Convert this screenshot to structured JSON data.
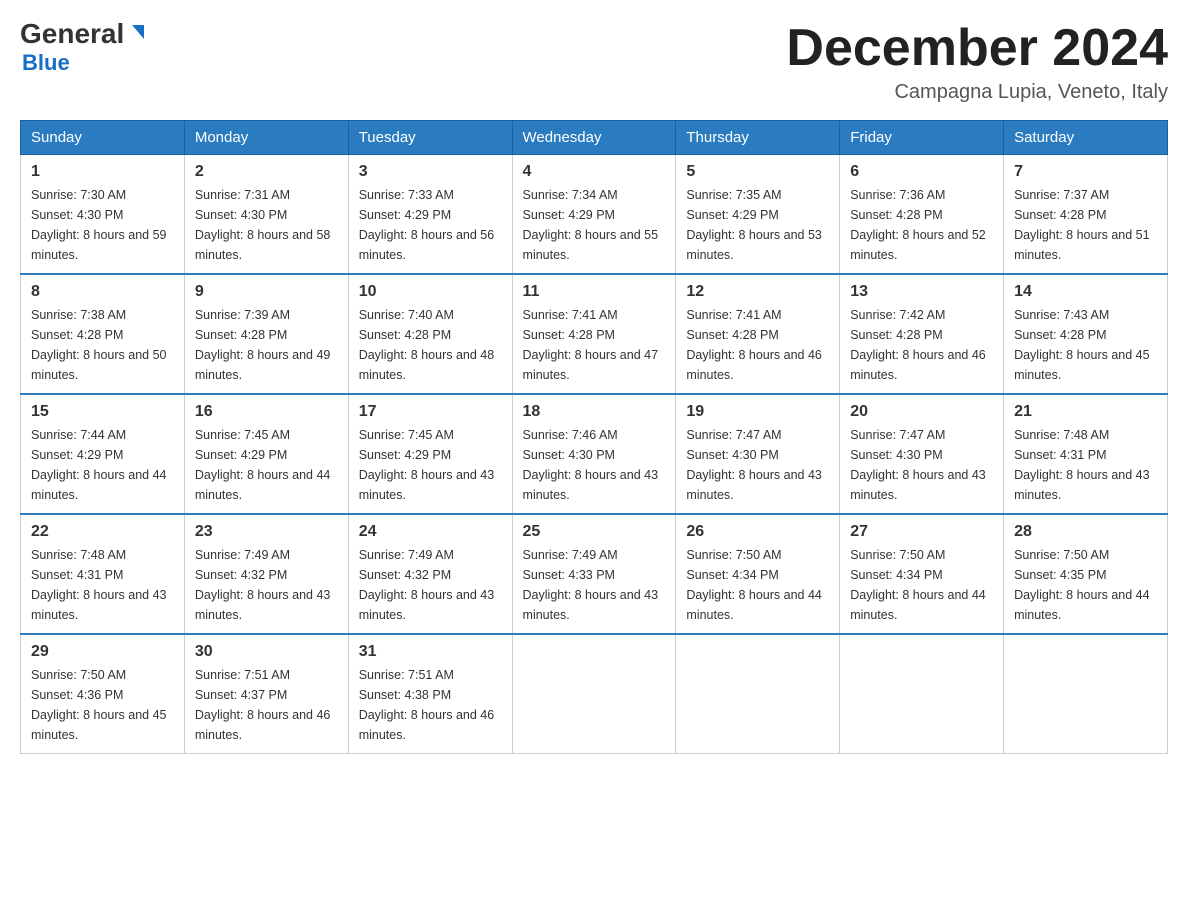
{
  "logo": {
    "general": "General",
    "blue": "Blue"
  },
  "title": "December 2024",
  "subtitle": "Campagna Lupia, Veneto, Italy",
  "weekdays": [
    "Sunday",
    "Monday",
    "Tuesday",
    "Wednesday",
    "Thursday",
    "Friday",
    "Saturday"
  ],
  "weeks": [
    [
      {
        "day": "1",
        "sunrise": "7:30 AM",
        "sunset": "4:30 PM",
        "daylight": "8 hours and 59 minutes."
      },
      {
        "day": "2",
        "sunrise": "7:31 AM",
        "sunset": "4:30 PM",
        "daylight": "8 hours and 58 minutes."
      },
      {
        "day": "3",
        "sunrise": "7:33 AM",
        "sunset": "4:29 PM",
        "daylight": "8 hours and 56 minutes."
      },
      {
        "day": "4",
        "sunrise": "7:34 AM",
        "sunset": "4:29 PM",
        "daylight": "8 hours and 55 minutes."
      },
      {
        "day": "5",
        "sunrise": "7:35 AM",
        "sunset": "4:29 PM",
        "daylight": "8 hours and 53 minutes."
      },
      {
        "day": "6",
        "sunrise": "7:36 AM",
        "sunset": "4:28 PM",
        "daylight": "8 hours and 52 minutes."
      },
      {
        "day": "7",
        "sunrise": "7:37 AM",
        "sunset": "4:28 PM",
        "daylight": "8 hours and 51 minutes."
      }
    ],
    [
      {
        "day": "8",
        "sunrise": "7:38 AM",
        "sunset": "4:28 PM",
        "daylight": "8 hours and 50 minutes."
      },
      {
        "day": "9",
        "sunrise": "7:39 AM",
        "sunset": "4:28 PM",
        "daylight": "8 hours and 49 minutes."
      },
      {
        "day": "10",
        "sunrise": "7:40 AM",
        "sunset": "4:28 PM",
        "daylight": "8 hours and 48 minutes."
      },
      {
        "day": "11",
        "sunrise": "7:41 AM",
        "sunset": "4:28 PM",
        "daylight": "8 hours and 47 minutes."
      },
      {
        "day": "12",
        "sunrise": "7:41 AM",
        "sunset": "4:28 PM",
        "daylight": "8 hours and 46 minutes."
      },
      {
        "day": "13",
        "sunrise": "7:42 AM",
        "sunset": "4:28 PM",
        "daylight": "8 hours and 46 minutes."
      },
      {
        "day": "14",
        "sunrise": "7:43 AM",
        "sunset": "4:28 PM",
        "daylight": "8 hours and 45 minutes."
      }
    ],
    [
      {
        "day": "15",
        "sunrise": "7:44 AM",
        "sunset": "4:29 PM",
        "daylight": "8 hours and 44 minutes."
      },
      {
        "day": "16",
        "sunrise": "7:45 AM",
        "sunset": "4:29 PM",
        "daylight": "8 hours and 44 minutes."
      },
      {
        "day": "17",
        "sunrise": "7:45 AM",
        "sunset": "4:29 PM",
        "daylight": "8 hours and 43 minutes."
      },
      {
        "day": "18",
        "sunrise": "7:46 AM",
        "sunset": "4:30 PM",
        "daylight": "8 hours and 43 minutes."
      },
      {
        "day": "19",
        "sunrise": "7:47 AM",
        "sunset": "4:30 PM",
        "daylight": "8 hours and 43 minutes."
      },
      {
        "day": "20",
        "sunrise": "7:47 AM",
        "sunset": "4:30 PM",
        "daylight": "8 hours and 43 minutes."
      },
      {
        "day": "21",
        "sunrise": "7:48 AM",
        "sunset": "4:31 PM",
        "daylight": "8 hours and 43 minutes."
      }
    ],
    [
      {
        "day": "22",
        "sunrise": "7:48 AM",
        "sunset": "4:31 PM",
        "daylight": "8 hours and 43 minutes."
      },
      {
        "day": "23",
        "sunrise": "7:49 AM",
        "sunset": "4:32 PM",
        "daylight": "8 hours and 43 minutes."
      },
      {
        "day": "24",
        "sunrise": "7:49 AM",
        "sunset": "4:32 PM",
        "daylight": "8 hours and 43 minutes."
      },
      {
        "day": "25",
        "sunrise": "7:49 AM",
        "sunset": "4:33 PM",
        "daylight": "8 hours and 43 minutes."
      },
      {
        "day": "26",
        "sunrise": "7:50 AM",
        "sunset": "4:34 PM",
        "daylight": "8 hours and 44 minutes."
      },
      {
        "day": "27",
        "sunrise": "7:50 AM",
        "sunset": "4:34 PM",
        "daylight": "8 hours and 44 minutes."
      },
      {
        "day": "28",
        "sunrise": "7:50 AM",
        "sunset": "4:35 PM",
        "daylight": "8 hours and 44 minutes."
      }
    ],
    [
      {
        "day": "29",
        "sunrise": "7:50 AM",
        "sunset": "4:36 PM",
        "daylight": "8 hours and 45 minutes."
      },
      {
        "day": "30",
        "sunrise": "7:51 AM",
        "sunset": "4:37 PM",
        "daylight": "8 hours and 46 minutes."
      },
      {
        "day": "31",
        "sunrise": "7:51 AM",
        "sunset": "4:38 PM",
        "daylight": "8 hours and 46 minutes."
      },
      null,
      null,
      null,
      null
    ]
  ]
}
